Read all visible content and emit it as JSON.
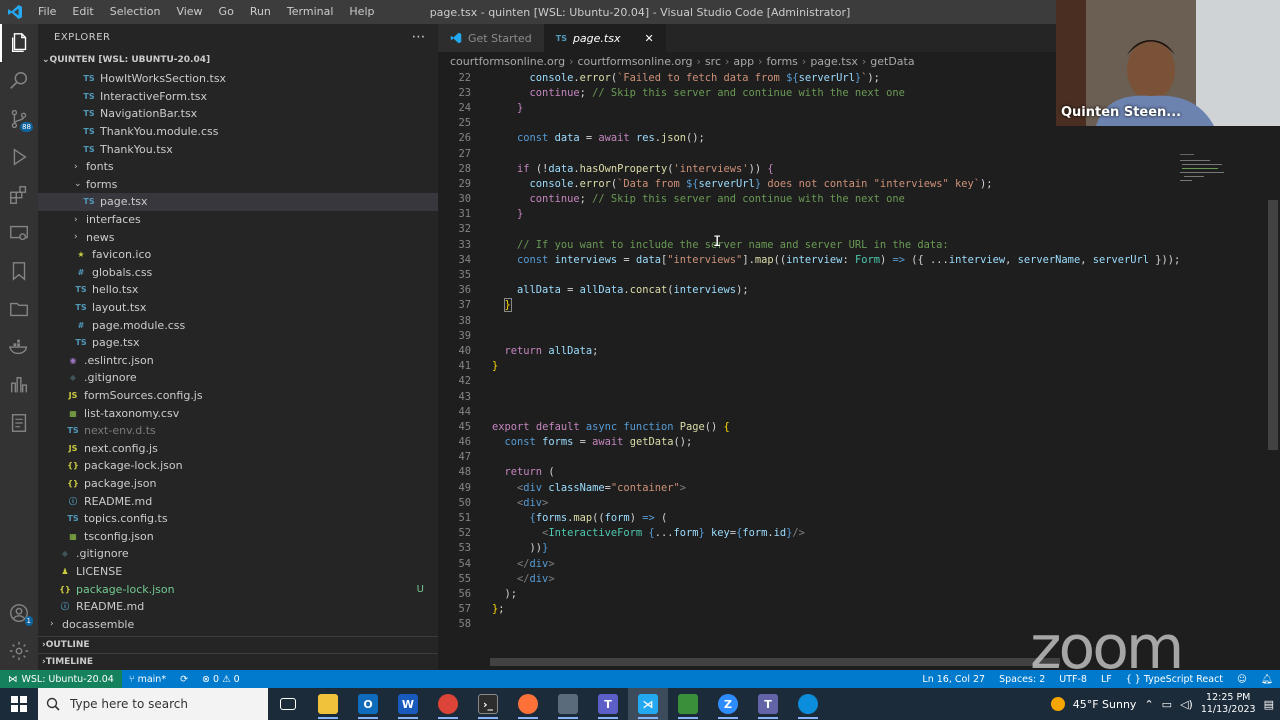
{
  "window": {
    "title": "page.tsx - quinten [WSL: Ubuntu-20.04] - Visual Studio Code [Administrator]",
    "menu": [
      "File",
      "Edit",
      "Selection",
      "View",
      "Go",
      "Run",
      "Terminal",
      "Help"
    ]
  },
  "activity_bar": {
    "scm_badge": "88",
    "account_badge": "1"
  },
  "explorer": {
    "title": "EXPLORER",
    "section": "QUINTEN [WSL: UBUNTU-20.04]",
    "items": [
      {
        "label": "HowItWorksSection.tsx",
        "icon": "TS",
        "indent": 3
      },
      {
        "label": "InteractiveForm.tsx",
        "icon": "TS",
        "indent": 3
      },
      {
        "label": "NavigationBar.tsx",
        "icon": "TS",
        "indent": 3
      },
      {
        "label": "ThankYou.module.css",
        "icon": "TS",
        "indent": 3
      },
      {
        "label": "ThankYou.tsx",
        "icon": "TS",
        "indent": 3
      },
      {
        "label": "fonts",
        "icon": "",
        "indent": 2,
        "folder": "closed"
      },
      {
        "label": "forms",
        "icon": "",
        "indent": 2,
        "folder": "open"
      },
      {
        "label": "page.tsx",
        "icon": "TS",
        "indent": 3,
        "selected": true
      },
      {
        "label": "interfaces",
        "icon": "",
        "indent": 2,
        "folder": "closed"
      },
      {
        "label": "news",
        "icon": "",
        "indent": 2,
        "folder": "closed"
      },
      {
        "label": "favicon.ico",
        "icon": "★",
        "indent": 2
      },
      {
        "label": "globals.css",
        "icon": "#",
        "indent": 2
      },
      {
        "label": "hello.tsx",
        "icon": "TS",
        "indent": 2
      },
      {
        "label": "layout.tsx",
        "icon": "TS",
        "indent": 2
      },
      {
        "label": "page.module.css",
        "icon": "#",
        "indent": 2
      },
      {
        "label": "page.tsx",
        "icon": "TS",
        "indent": 2
      },
      {
        "label": ".eslintrc.json",
        "icon": "◉",
        "indent": 1
      },
      {
        "label": ".gitignore",
        "icon": "◆",
        "indent": 1
      },
      {
        "label": "formSources.config.js",
        "icon": "JS",
        "indent": 1
      },
      {
        "label": "list-taxonomy.csv",
        "icon": "▦",
        "indent": 1
      },
      {
        "label": "next-env.d.ts",
        "icon": "TS",
        "indent": 1,
        "dim": true
      },
      {
        "label": "next.config.js",
        "icon": "JS",
        "indent": 1
      },
      {
        "label": "package-lock.json",
        "icon": "{}",
        "indent": 1
      },
      {
        "label": "package.json",
        "icon": "{}",
        "indent": 1
      },
      {
        "label": "README.md",
        "icon": "ⓘ",
        "indent": 1
      },
      {
        "label": "topics.config.ts",
        "icon": "TS",
        "indent": 1
      },
      {
        "label": "tsconfig.json",
        "icon": "▦",
        "indent": 1
      },
      {
        "label": ".gitignore",
        "icon": "◆",
        "indent": 0
      },
      {
        "label": "LICENSE",
        "icon": "♟",
        "indent": 0
      },
      {
        "label": "package-lock.json",
        "icon": "{}",
        "indent": 0,
        "git": "U"
      },
      {
        "label": "README.md",
        "icon": "ⓘ",
        "indent": 0
      },
      {
        "label": "docassemble",
        "icon": "",
        "indent": -1,
        "folder": "closed"
      }
    ],
    "outline": "OUTLINE",
    "timeline": "TIMELINE"
  },
  "tabs": [
    {
      "label": "Get Started",
      "active": false
    },
    {
      "label": "page.tsx",
      "active": true
    }
  ],
  "breadcrumb": [
    "courtformsonline.org",
    "courtformsonline.org",
    "src",
    "app",
    "forms",
    "page.tsx",
    "getData"
  ],
  "code_lines": [
    {
      "n": "22",
      "html": "      <span class='var'>console</span><span class='pl'>.</span><span class='fn'>error</span><span class='pl'>(</span><span class='str'>`Failed to fetch data from </span><span class='kw'>${</span><span class='var'>serverUrl</span><span class='kw'>}</span><span class='str'>`</span><span class='pl'>);</span>"
    },
    {
      "n": "23",
      "html": "      <span class='ctl'>continue</span><span class='pl'>; </span><span class='cm'>// Skip this server and continue with the next one</span>"
    },
    {
      "n": "24",
      "html": "    <span class='ctl'>}</span>"
    },
    {
      "n": "25",
      "html": ""
    },
    {
      "n": "26",
      "html": "    <span class='kw'>const</span> <span class='var'>data</span> <span class='pl'>=</span> <span class='ctl'>await</span> <span class='var'>res</span><span class='pl'>.</span><span class='fn'>json</span><span class='pl'>();</span>"
    },
    {
      "n": "27",
      "html": ""
    },
    {
      "n": "28",
      "html": "    <span class='ctl'>if</span> <span class='pl'>(!</span><span class='var'>data</span><span class='pl'>.</span><span class='fn'>hasOwnProperty</span><span class='pl'>(</span><span class='str'>'interviews'</span><span class='pl'>)) </span><span class='ctl'>{</span>"
    },
    {
      "n": "29",
      "html": "      <span class='var'>console</span><span class='pl'>.</span><span class='fn'>error</span><span class='pl'>(</span><span class='str'>`Data from </span><span class='kw'>${</span><span class='var'>serverUrl</span><span class='kw'>}</span><span class='str'> does not contain \"interviews\" key`</span><span class='pl'>);</span>"
    },
    {
      "n": "30",
      "html": "      <span class='ctl'>continue</span><span class='pl'>; </span><span class='cm'>// Skip this server and continue with the next one</span>"
    },
    {
      "n": "31",
      "html": "    <span class='ctl'>}</span>"
    },
    {
      "n": "32",
      "html": ""
    },
    {
      "n": "33",
      "html": "    <span class='cm'>// If you want to include the server name and server URL in the data:</span>"
    },
    {
      "n": "34",
      "html": "    <span class='kw'>const</span> <span class='var'>interviews</span> <span class='pl'>=</span> <span class='var'>data</span><span class='pl'>[</span><span class='str'>\"interviews\"</span><span class='pl'>].</span><span class='fn'>map</span><span class='pl'>((</span><span class='var'>interview</span><span class='pl'>: </span><span class='ty'>Form</span><span class='pl'>) </span><span class='kw'>=&gt;</span><span class='pl'> ({ ...</span><span class='var'>interview</span><span class='pl'>, </span><span class='var'>serverName</span><span class='pl'>, </span><span class='var'>serverUrl</span><span class='pl'> }));</span>"
    },
    {
      "n": "35",
      "html": ""
    },
    {
      "n": "36",
      "html": "    <span class='var'>allData</span> <span class='pl'>=</span> <span class='var'>allData</span><span class='pl'>.</span><span class='fn'>concat</span><span class='pl'>(</span><span class='var'>interviews</span><span class='pl'>);</span>"
    },
    {
      "n": "37",
      "html": "  <span class='bra' style='outline:1px solid #888'>}</span>"
    },
    {
      "n": "38",
      "html": ""
    },
    {
      "n": "39",
      "html": ""
    },
    {
      "n": "40",
      "html": "  <span class='ctl'>return</span> <span class='var'>allData</span><span class='pl'>;</span>"
    },
    {
      "n": "41",
      "html": "<span class='bra'>}</span>"
    },
    {
      "n": "42",
      "html": ""
    },
    {
      "n": "43",
      "html": ""
    },
    {
      "n": "44",
      "html": ""
    },
    {
      "n": "45",
      "html": "<span class='ctl'>export</span> <span class='ctl'>default</span> <span class='kw'>async</span> <span class='kw'>function</span> <span class='fn'>Page</span><span class='pl'>() </span><span class='bra'>{</span>"
    },
    {
      "n": "46",
      "html": "  <span class='kw'>const</span> <span class='var'>forms</span> <span class='pl'>=</span> <span class='ctl'>await</span> <span class='fn'>getData</span><span class='pl'>();</span>"
    },
    {
      "n": "47",
      "html": ""
    },
    {
      "n": "48",
      "html": "  <span class='ctl'>return</span> <span class='pl'>(</span>"
    },
    {
      "n": "49",
      "html": "    <span class='tag'>&lt;</span><span class='tn'>div</span> <span class='var'>className</span><span class='pl'>=</span><span class='str'>\"container\"</span><span class='tag'>&gt;</span>"
    },
    {
      "n": "50",
      "html": "    <span class='tag'>&lt;</span><span class='tn'>div</span><span class='tag'>&gt;</span>"
    },
    {
      "n": "51",
      "html": "      <span class='kw'>{</span><span class='var'>forms</span><span class='pl'>.</span><span class='fn'>map</span><span class='pl'>((</span><span class='var'>form</span><span class='pl'>) </span><span class='kw'>=&gt;</span><span class='pl'> (</span>"
    },
    {
      "n": "52",
      "html": "        <span class='tag'>&lt;</span><span class='ty'>InteractiveForm</span> <span class='kw'>{</span><span class='pl'>...</span><span class='var'>form</span><span class='kw'>}</span> <span class='var'>key</span><span class='pl'>=</span><span class='kw'>{</span><span class='var'>form</span><span class='pl'>.</span><span class='var'>id</span><span class='kw'>}</span><span class='tag'>/&gt;</span>"
    },
    {
      "n": "53",
      "html": "      <span class='pl'>))</span><span class='kw'>}</span>"
    },
    {
      "n": "54",
      "html": "    <span class='tag'>&lt;/</span><span class='tn'>div</span><span class='tag'>&gt;</span>"
    },
    {
      "n": "55",
      "html": "    <span class='tag'>&lt;/</span><span class='tn'>div</span><span class='tag'>&gt;</span>"
    },
    {
      "n": "56",
      "html": "  <span class='pl'>);</span>"
    },
    {
      "n": "57",
      "html": "<span class='bra'>}</span><span class='pl'>;</span>"
    },
    {
      "n": "58",
      "html": ""
    }
  ],
  "statusbar": {
    "remote": "WSL: Ubuntu-20.04",
    "branch": "main*",
    "sync": "⟳",
    "problems": "⊗ 0 ⚠ 0",
    "position": "Ln 16, Col 27",
    "spaces": "Spaces: 2",
    "encoding": "UTF-8",
    "eol": "LF",
    "language": "{ } TypeScript React"
  },
  "taskbar": {
    "search_placeholder": "Type here to search",
    "weather": "45°F  Sunny",
    "time": "12:25 PM",
    "date": "11/13/2023"
  },
  "video": {
    "participant": "Quinten Steen..."
  },
  "zoom_logo": "zoom",
  "colors": {
    "statusbar": "#007acc",
    "activity": "#333333",
    "sidebar": "#252526",
    "editor": "#1e1e1e"
  }
}
